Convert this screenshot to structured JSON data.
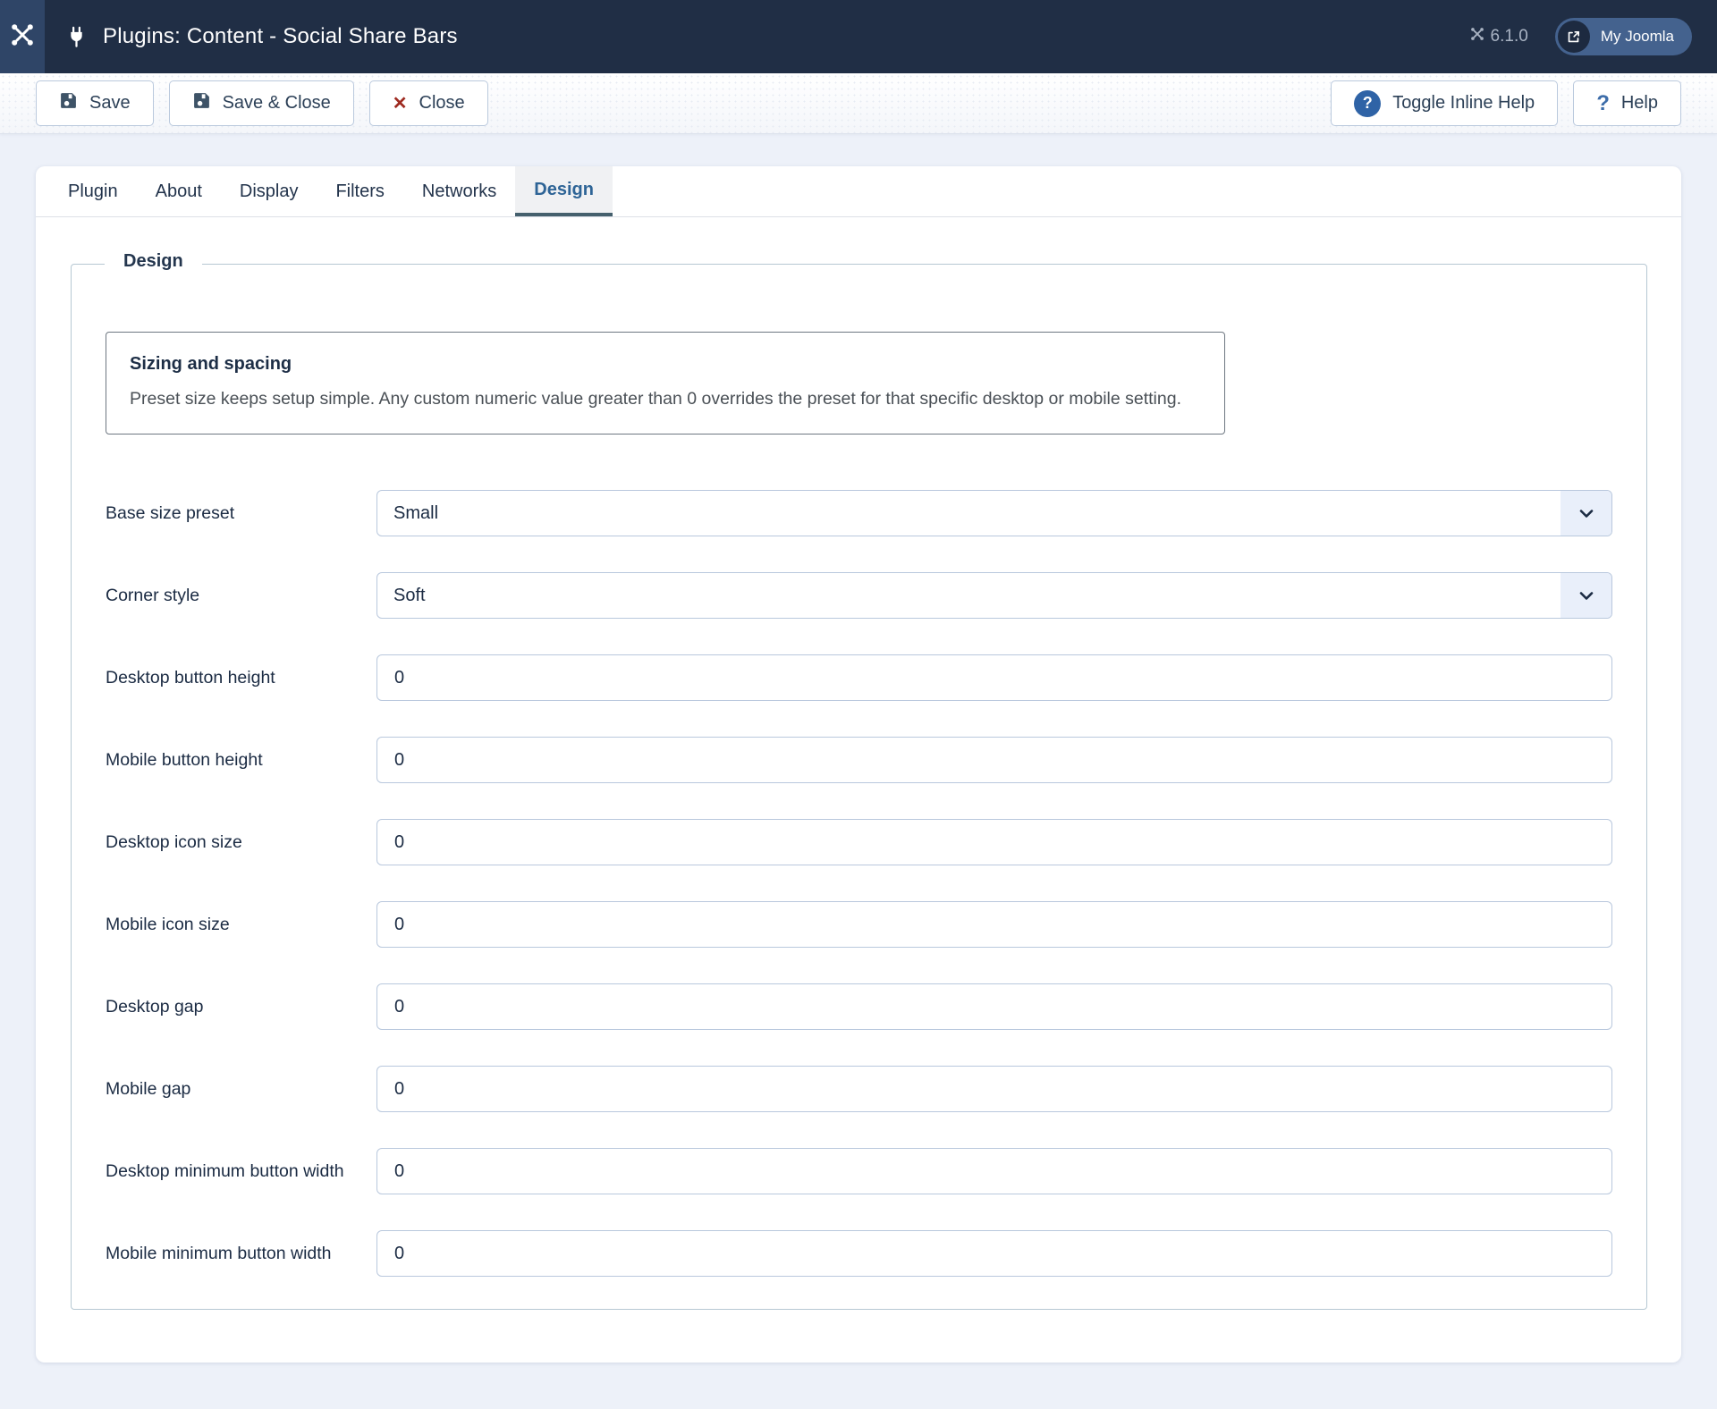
{
  "header": {
    "title": "Plugins: Content - Social Share Bars",
    "version": "6.1.0",
    "account_label": "My Joomla"
  },
  "toolbar": {
    "save": "Save",
    "save_and_close": "Save & Close",
    "close": "Close",
    "toggle_inline_help": "Toggle Inline Help",
    "help": "Help"
  },
  "tabs": [
    {
      "label": "Plugin",
      "active": false
    },
    {
      "label": "About",
      "active": false
    },
    {
      "label": "Display",
      "active": false
    },
    {
      "label": "Filters",
      "active": false
    },
    {
      "label": "Networks",
      "active": false
    },
    {
      "label": "Design",
      "active": true
    }
  ],
  "section": {
    "legend": "Design"
  },
  "notice": {
    "title": "Sizing and spacing",
    "body": "Preset size keeps setup simple. Any custom numeric value greater than 0 overrides the preset for that specific desktop or mobile setting."
  },
  "form": {
    "rows": [
      {
        "label": "Base size preset",
        "type": "select",
        "value": "Small"
      },
      {
        "label": "Corner style",
        "type": "select",
        "value": "Soft"
      },
      {
        "label": "Desktop button height",
        "type": "number",
        "value": "0"
      },
      {
        "label": "Mobile button height",
        "type": "number",
        "value": "0"
      },
      {
        "label": "Desktop icon size",
        "type": "number",
        "value": "0"
      },
      {
        "label": "Mobile icon size",
        "type": "number",
        "value": "0"
      },
      {
        "label": "Desktop gap",
        "type": "number",
        "value": "0"
      },
      {
        "label": "Mobile gap",
        "type": "number",
        "value": "0"
      },
      {
        "label": "Desktop minimum button width",
        "type": "number",
        "value": "0"
      },
      {
        "label": "Mobile minimum button width",
        "type": "number",
        "value": "0"
      }
    ]
  },
  "icons": {
    "logo": "joomla-logo-icon",
    "page": "plug-icon",
    "version": "joomla-mark-icon",
    "account": "external-link-icon",
    "save": "floppy-disk-icon",
    "close": "x-icon",
    "toggle_inline_help": "question-circle-icon",
    "help": "question-mark-icon",
    "select": "chevron-down-icon"
  },
  "colors": {
    "header_bg": "#202e45",
    "logo_tile_bg": "#2f4567",
    "account_pill_bg": "#44628e",
    "page_bg": "#edf1f9",
    "accent_blue": "#2e6496",
    "active_tab_border": "#45606d",
    "close_red": "#9e2a20",
    "help_blue": "#2f63a6",
    "input_border": "#b9c8dd",
    "fieldset_border": "#b6c8d3"
  }
}
